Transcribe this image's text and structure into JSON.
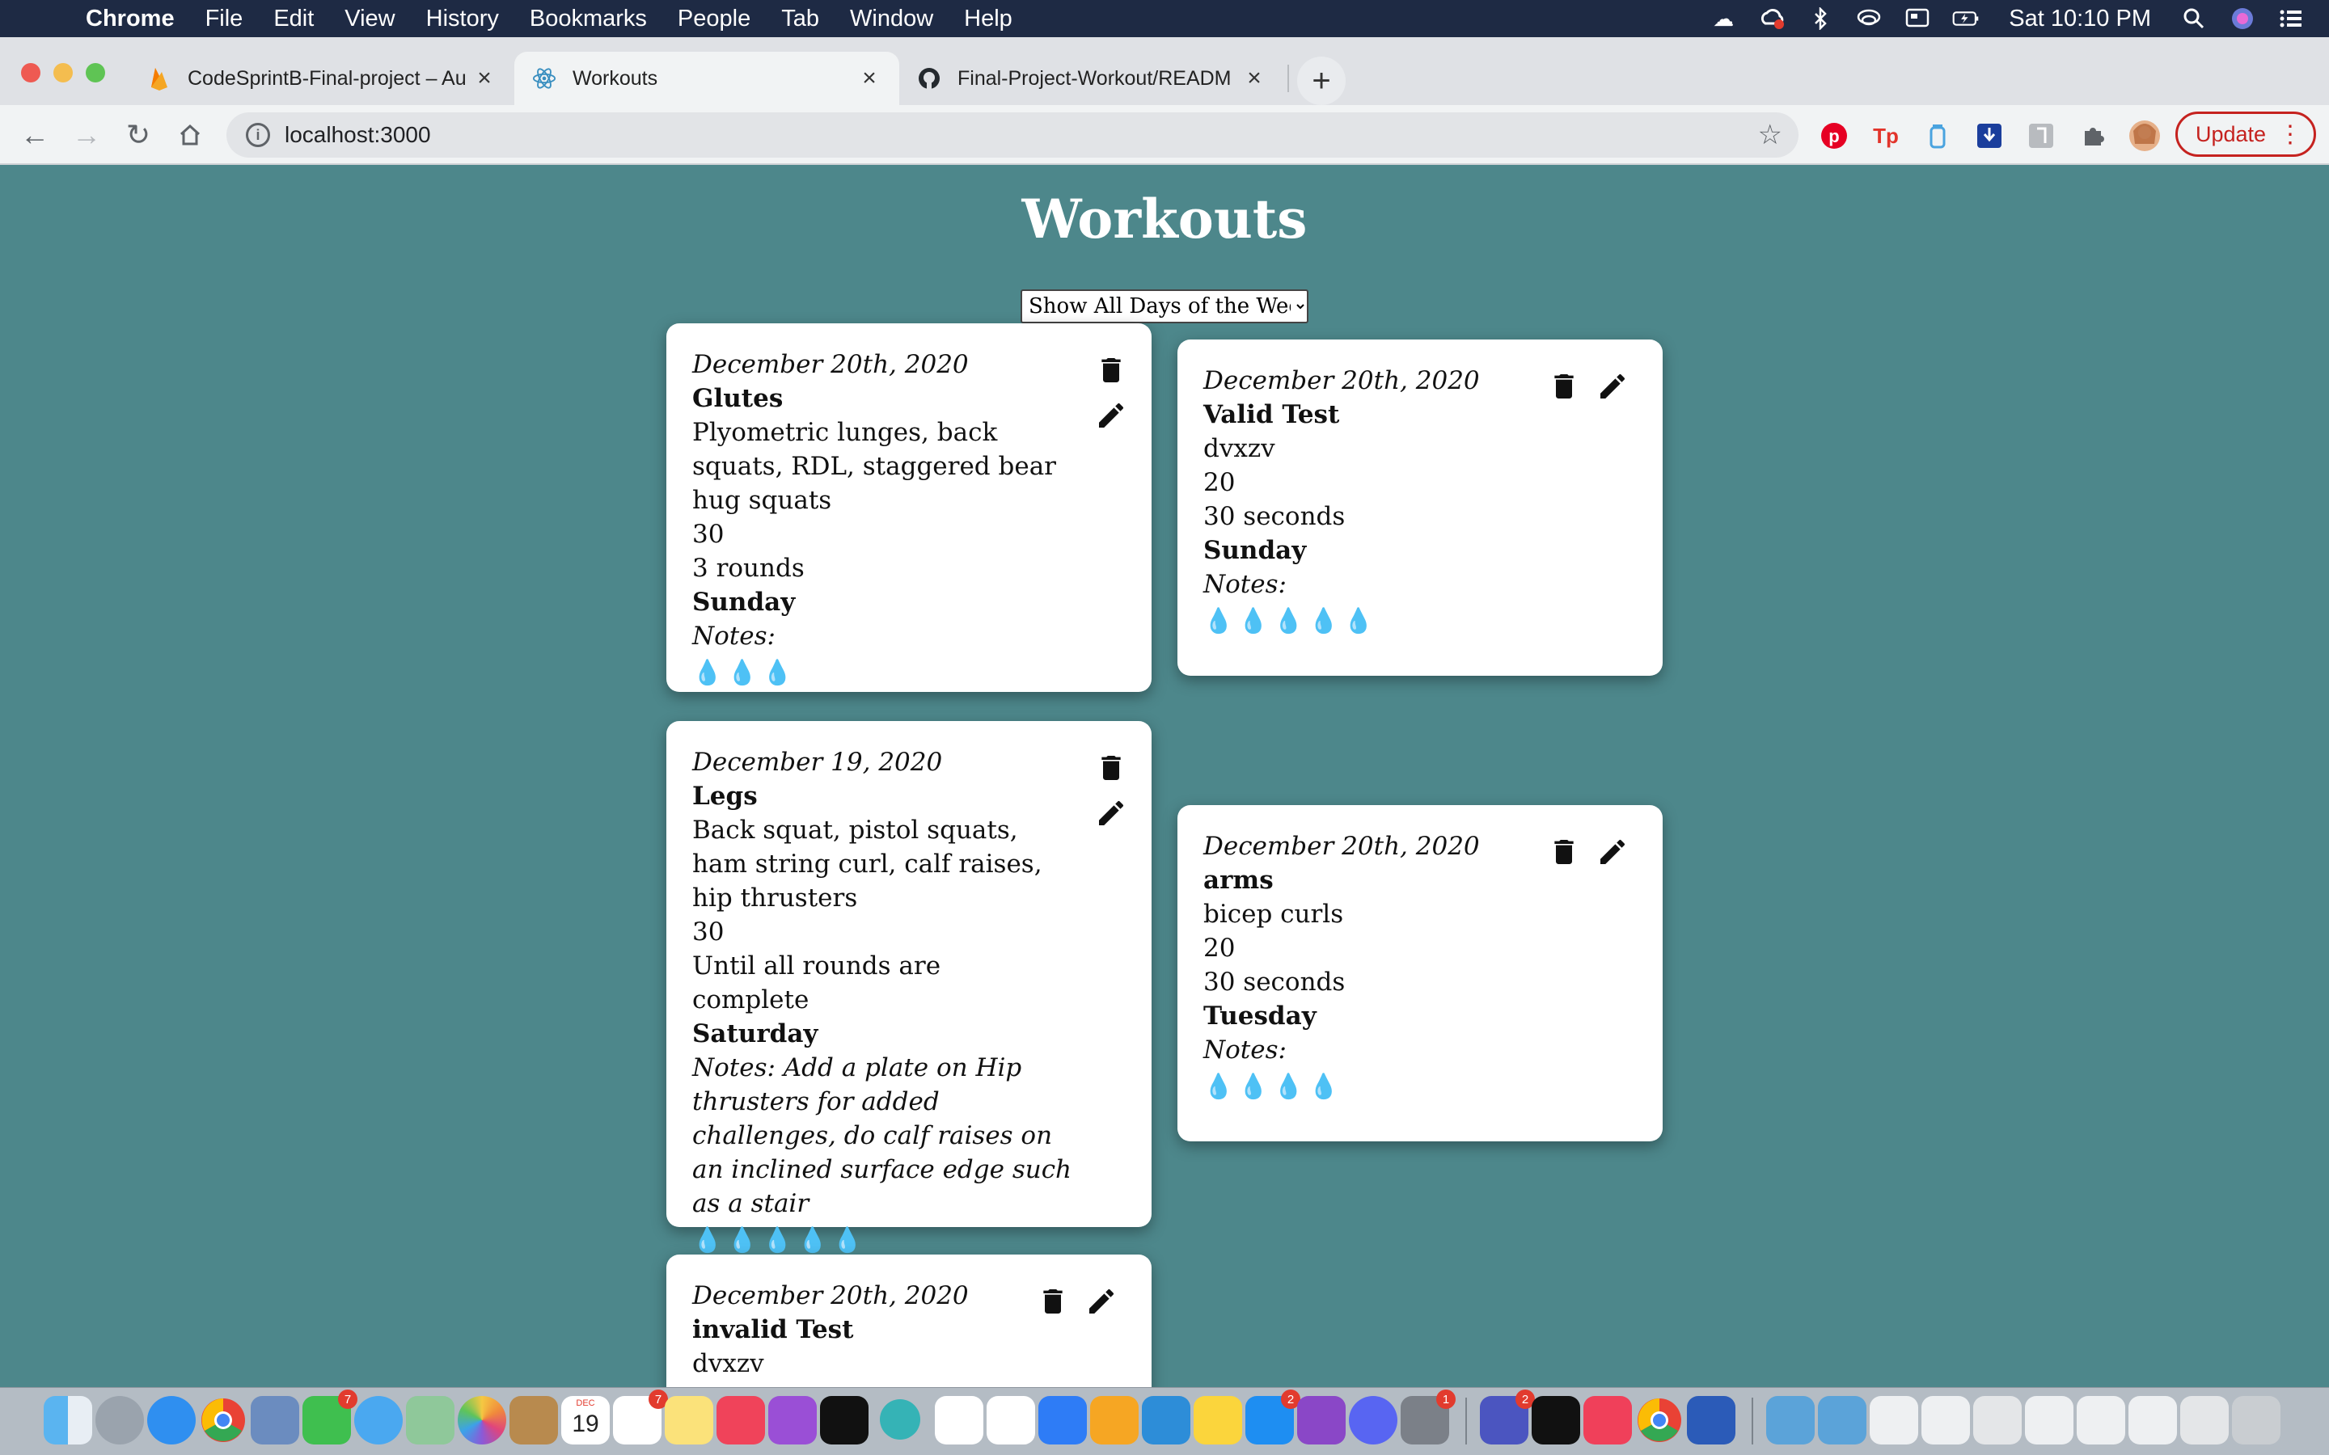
{
  "menubar": {
    "app": "Chrome",
    "items": [
      "File",
      "Edit",
      "View",
      "History",
      "Bookmarks",
      "People",
      "Tab",
      "Window",
      "Help"
    ],
    "clock": "Sat 10:10 PM"
  },
  "tabs": [
    {
      "title": "CodeSprintB-Final-project – Au",
      "favicon": "firebase-icon"
    },
    {
      "title": "Workouts",
      "favicon": "react-icon"
    },
    {
      "title": "Final-Project-Workout/READM",
      "favicon": "github-icon"
    }
  ],
  "toolbar": {
    "url": "localhost:3000",
    "update_label": "Update"
  },
  "page": {
    "title": "Workouts",
    "filter": {
      "selected": "Show All Days of the Week",
      "options": [
        "Show All Days of the Week"
      ]
    },
    "workouts": [
      {
        "date": "December 20th, 2020",
        "name": "Glutes",
        "exercises": "Plyometric lunges, back squats, RDL, staggered bear hug squats",
        "reps": "30",
        "rounds": "3 rounds",
        "day": "Sunday",
        "notes": "Notes:",
        "intensity": "💧💧💧",
        "intensity_level": 3
      },
      {
        "date": "December 20th, 2020",
        "name": "Valid Test",
        "exercises": "dvxzv",
        "reps": "20",
        "rounds": "30 seconds",
        "day": "Sunday",
        "notes": "Notes:",
        "intensity": "💧💧💧💧💧",
        "intensity_level": 5
      },
      {
        "date": "December 19, 2020",
        "name": "Legs",
        "exercises": "Back squat, pistol squats, ham string curl, calf raises, hip thrusters",
        "reps": "30",
        "rounds": "Until all rounds are complete",
        "day": "Saturday",
        "notes": "Notes: Add a plate on Hip thrusters for added challenges, do calf raises on an inclined surface edge such as a stair",
        "intensity": "💧💧💧💧💧",
        "intensity_level": 5
      },
      {
        "date": "December 20th, 2020",
        "name": "arms",
        "exercises": "bicep curls",
        "reps": "20",
        "rounds": "30 seconds",
        "day": "Tuesday",
        "notes": "Notes:",
        "intensity": "💧💧💧💧",
        "intensity_level": 4
      },
      {
        "date": "December 20th, 2020",
        "name": "invalid Test",
        "exercises": "dvxzv"
      }
    ]
  },
  "dock": {
    "badges": {
      "facetime": "7",
      "calendar_date": "19",
      "calendar_month": "DEC",
      "reminders": "7",
      "appstore": "2",
      "teams": "2",
      "settings": "1"
    }
  },
  "colors": {
    "page_bg": "#4d878b",
    "card_bg": "#ffffff",
    "drop": "#2fa6e0",
    "update_red": "#c5221f",
    "menubar": "#1e2a44"
  }
}
